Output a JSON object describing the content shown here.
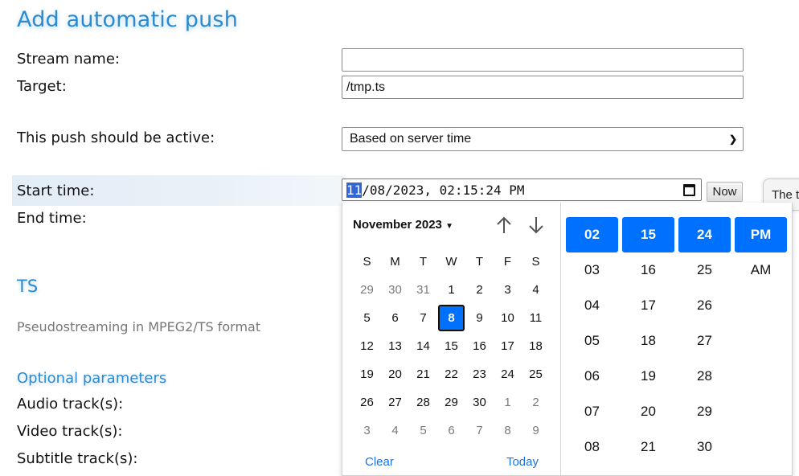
{
  "page": {
    "title": "Add automatic push"
  },
  "form": {
    "stream_name_label": "Stream name:",
    "stream_name_value": "",
    "target_label": "Target:",
    "target_value": "/tmp.ts",
    "active_label": "This push should be active:",
    "active_value": "Based on server time",
    "start_time_label": "Start time:",
    "start_time": {
      "selected_segment": "11",
      "rest": "/08/2023, 02:15:24 PM"
    },
    "end_time_label": "End time:",
    "now_button": "Now",
    "tooltip_text": "The t"
  },
  "section": {
    "title": "TS",
    "description": "Pseudostreaming in MPEG2/TS format",
    "optional_title": "Optional parameters",
    "audio_label": "Audio track(s):",
    "video_label": "Video track(s):",
    "subtitle_label": "Subtitle track(s):"
  },
  "picker": {
    "month_label": "November 2023",
    "weekdays": [
      "S",
      "M",
      "T",
      "W",
      "T",
      "F",
      "S"
    ],
    "weeks": [
      [
        {
          "d": "29",
          "o": true
        },
        {
          "d": "30",
          "o": true
        },
        {
          "d": "31",
          "o": true
        },
        {
          "d": "1"
        },
        {
          "d": "2"
        },
        {
          "d": "3"
        },
        {
          "d": "4"
        }
      ],
      [
        {
          "d": "5"
        },
        {
          "d": "6"
        },
        {
          "d": "7"
        },
        {
          "d": "8",
          "sel": true
        },
        {
          "d": "9"
        },
        {
          "d": "10"
        },
        {
          "d": "11"
        }
      ],
      [
        {
          "d": "12"
        },
        {
          "d": "13"
        },
        {
          "d": "14"
        },
        {
          "d": "15"
        },
        {
          "d": "16"
        },
        {
          "d": "17"
        },
        {
          "d": "18"
        }
      ],
      [
        {
          "d": "19"
        },
        {
          "d": "20"
        },
        {
          "d": "21"
        },
        {
          "d": "22"
        },
        {
          "d": "23"
        },
        {
          "d": "24"
        },
        {
          "d": "25"
        }
      ],
      [
        {
          "d": "26"
        },
        {
          "d": "27"
        },
        {
          "d": "28"
        },
        {
          "d": "29"
        },
        {
          "d": "30"
        },
        {
          "d": "1",
          "o": true
        },
        {
          "d": "2",
          "o": true
        }
      ],
      [
        {
          "d": "3",
          "o": true
        },
        {
          "d": "4",
          "o": true
        },
        {
          "d": "5",
          "o": true
        },
        {
          "d": "6",
          "o": true
        },
        {
          "d": "7",
          "o": true
        },
        {
          "d": "8",
          "o": true
        },
        {
          "d": "9",
          "o": true
        }
      ]
    ],
    "clear_label": "Clear",
    "today_label": "Today",
    "hours": [
      "02",
      "03",
      "04",
      "05",
      "06",
      "07",
      "08"
    ],
    "minutes": [
      "15",
      "16",
      "17",
      "18",
      "19",
      "20",
      "21"
    ],
    "seconds": [
      "24",
      "25",
      "26",
      "27",
      "28",
      "29",
      "30"
    ],
    "ampm": [
      "PM",
      "AM"
    ],
    "selected": {
      "hour": "02",
      "minute": "15",
      "second": "24",
      "ampm": "PM"
    }
  },
  "colors": {
    "accent": "#2b8bd0",
    "selection": "#0070ff",
    "link": "#1a73e8"
  }
}
